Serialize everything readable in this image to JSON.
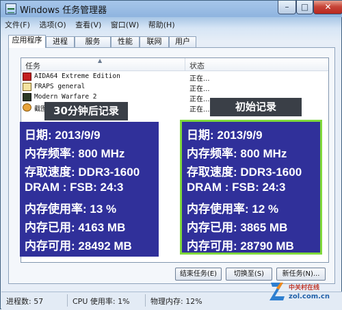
{
  "window": {
    "title": "Windows 任务管理器",
    "minimize": "–",
    "maximize": "□",
    "close": "✕"
  },
  "menu": [
    "文件(F)",
    "选项(O)",
    "查看(V)",
    "窗口(W)",
    "帮助(H)"
  ],
  "tabs": [
    "应用程序",
    "进程",
    "服务",
    "性能",
    "联网",
    "用户"
  ],
  "active_tab": "应用程序",
  "table": {
    "headers": {
      "task": "任务",
      "status": "状态"
    },
    "rows": [
      {
        "name": "AIDA64 Extreme Edition",
        "status": "正在...",
        "icon": "aida64-icon"
      },
      {
        "name": "FRAPS general",
        "status": "正在...",
        "icon": "fraps-icon"
      },
      {
        "name": "Modern Warfare 2",
        "status": "正在...",
        "icon": "mw2-icon"
      },
      {
        "name": "截图",
        "status": "正在...",
        "icon": "screenshot-icon"
      }
    ]
  },
  "overlay_left": {
    "caption": "30分钟后记录",
    "lines": [
      "日期: 2013/9/9",
      "内存频率: 800 MHz",
      "存取速度: DDR3-1600",
      "DRAM : FSB: 24:3",
      "内存使用率: 13 %",
      "内存已用: 4163 MB",
      "内存可用: 28492 MB"
    ]
  },
  "overlay_right": {
    "caption": "初始记录",
    "lines": [
      "日期: 2013/9/9",
      "内存频率: 800 MHz",
      "存取速度: DDR3-1600",
      "DRAM : FSB: 24:3",
      "内存使用率: 12 %",
      "内存已用: 3865 MB",
      "内存可用: 28790 MB"
    ],
    "border_color": "#7fd83a"
  },
  "buttons": {
    "end_task": "结束任务(E)",
    "switch_to": "切换至(S)",
    "new_task": "新任务(N)..."
  },
  "status": {
    "processes": "进程数: 57",
    "cpu": "CPU 使用率: 1%",
    "memory": "物理内存: 12%"
  },
  "watermark": {
    "line1": "中关村在线",
    "line2": "zol.com.cn"
  },
  "colors": {
    "overlay_bg": "#30309a",
    "caption_bg": "#3a3f47",
    "titlebar": "#a7c6ea"
  }
}
